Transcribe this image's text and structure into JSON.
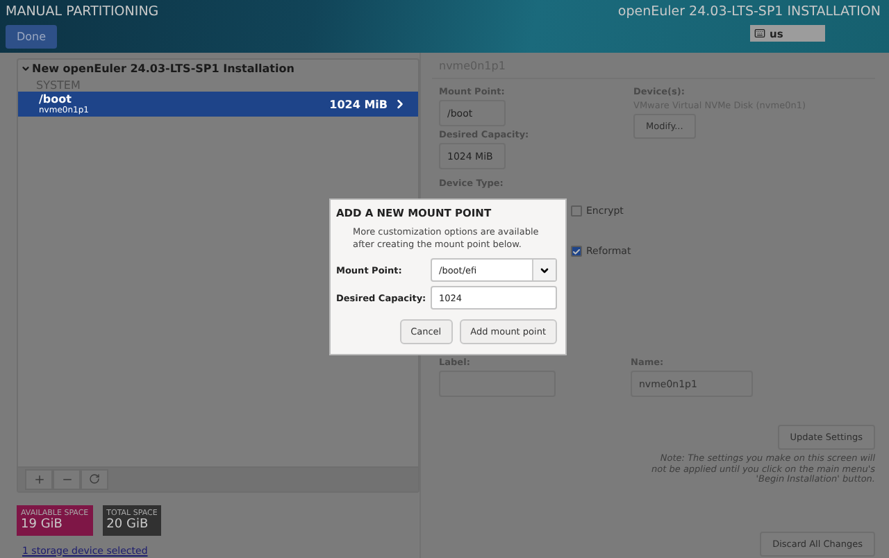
{
  "header": {
    "title": "MANUAL PARTITIONING",
    "done_button": "Done",
    "product": "openEuler 24.03-LTS-SP1 INSTALLATION",
    "keyboard": "us"
  },
  "partitions": {
    "group_title": "New openEuler 24.03-LTS-SP1 Installation",
    "expanded": true,
    "sections": [
      {
        "title": "SYSTEM",
        "items": [
          {
            "mount": "/boot",
            "device": "nvme0n1p1",
            "size": "1024 MiB",
            "selected": true
          }
        ]
      }
    ]
  },
  "space": [
    {
      "kind": "available",
      "label": "AVAILABLE SPACE",
      "value": "19 GiB"
    },
    {
      "kind": "total",
      "label": "TOTAL SPACE",
      "value": "20 GiB"
    }
  ],
  "storage_link": "1 storage device selected",
  "details": {
    "title": "nvme0n1p1",
    "mount_point_label": "Mount Point:",
    "mount_point": "/boot",
    "capacity_label": "Desired Capacity:",
    "capacity": "1024 MiB",
    "devices_label": "Device(s):",
    "devices": "VMware Virtual NVMe Disk (nvme0n1)",
    "modify_button": "Modify...",
    "device_type_label": "Device Type:",
    "encrypt": {
      "label": "Encrypt",
      "checked": false
    },
    "reformat": {
      "label": "Reformat",
      "checked": true
    },
    "label_label": "Label:",
    "name_label": "Name:",
    "name": "nvme0n1p1",
    "update_button": "Update Settings",
    "note": "Note: The settings you make on this screen will not be applied until you click on the main menu's 'Begin Installation' button.",
    "discard_button": "Discard All Changes"
  },
  "dialog": {
    "title": "ADD A NEW MOUNT POINT",
    "message": "More customization options are available after creating the mount point below.",
    "mount_point_label": "Mount Point:",
    "mount_point": "/boot/efi",
    "capacity_label": "Desired Capacity:",
    "capacity": "1024",
    "cancel_button": "Cancel",
    "add_button": "Add mount point"
  }
}
